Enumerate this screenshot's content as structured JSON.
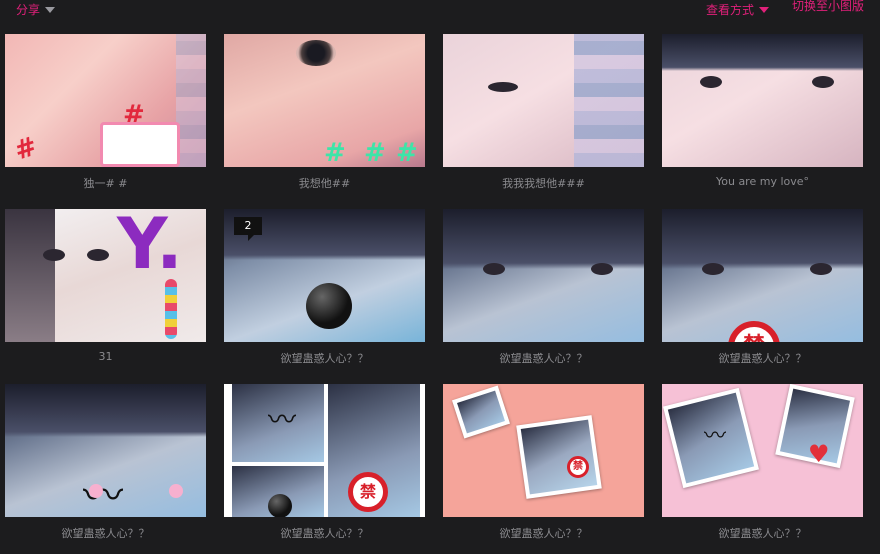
{
  "toolbar": {
    "share_label": "分享",
    "view_mode_label": "查看方式",
    "switch_small_label": "切换至小图版"
  },
  "photos": [
    {
      "caption": "独一# #"
    },
    {
      "caption": "我想他##"
    },
    {
      "caption": "我我我想他###"
    },
    {
      "caption": "You are my love°"
    },
    {
      "caption": "31"
    },
    {
      "caption": "欲望蛊惑人心？？",
      "badge": "2"
    },
    {
      "caption": "欲望蛊惑人心？？"
    },
    {
      "caption": "欲望蛊惑人心？？",
      "sticker_text": "禁"
    },
    {
      "caption": "欲望蛊惑人心？？"
    },
    {
      "caption": "欲望蛊惑人心？？",
      "sticker_text": "禁"
    },
    {
      "caption": "欲望蛊惑人心？？",
      "sticker_text": "禁"
    },
    {
      "caption": "欲望蛊惑人心？？"
    }
  ],
  "colors": {
    "accent": "#e0207a",
    "background": "#1c1c1e",
    "caption": "#8a8a8e"
  }
}
